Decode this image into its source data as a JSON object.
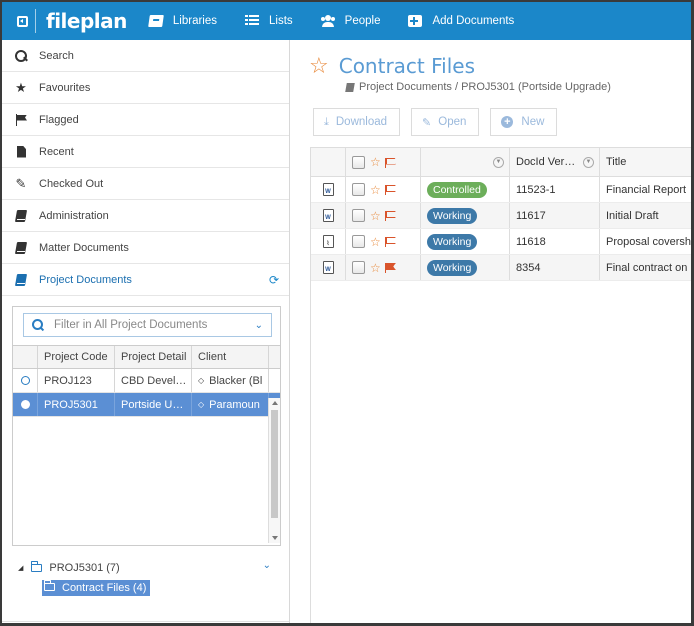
{
  "topbar": {
    "logo": "fileplan",
    "nav": [
      {
        "label": "Libraries",
        "icon": "book-icon"
      },
      {
        "label": "Lists",
        "icon": "list-icon"
      },
      {
        "label": "People",
        "icon": "people-icon"
      },
      {
        "label": "Add Documents",
        "icon": "plus-square-icon"
      }
    ]
  },
  "sidebar": {
    "items": [
      {
        "label": "Search",
        "icon": "search-icon"
      },
      {
        "label": "Favourites",
        "icon": "star-icon"
      },
      {
        "label": "Flagged",
        "icon": "flag-icon"
      },
      {
        "label": "Recent",
        "icon": "document-icon"
      },
      {
        "label": "Checked Out",
        "icon": "edit-icon"
      },
      {
        "label": "Administration",
        "icon": "book-icon"
      },
      {
        "label": "Matter Documents",
        "icon": "book-icon"
      },
      {
        "label": "Project Documents",
        "icon": "book-icon",
        "active": true
      }
    ],
    "filter_placeholder": "Filter in All Project Documents",
    "grid": {
      "columns": [
        "Project Code",
        "Project Detail",
        "Client"
      ],
      "rows": [
        {
          "code": "PROJ123",
          "detail": "CBD Devel…",
          "client": "Blacker (Bl",
          "selected": false
        },
        {
          "code": "PROJ5301",
          "detail": "Portside U…",
          "client": "Paramoun",
          "selected": true
        }
      ]
    },
    "tree": {
      "root": "PROJ5301 (7)",
      "child": "Contract Files (4)"
    }
  },
  "main": {
    "title": "Contract Files",
    "breadcrumb": "Project Documents / PROJ5301 (Portside Upgrade)",
    "toolbar": {
      "download": "Download",
      "open": "Open",
      "new": "New"
    },
    "grid": {
      "columns": [
        "",
        "",
        "",
        "DocId Ver…",
        "Title"
      ],
      "rows": [
        {
          "type": "W",
          "flagged": false,
          "status": "Controlled",
          "status_color": "#6cae5a",
          "docid": "11523-1",
          "title": "Financial Report"
        },
        {
          "type": "W",
          "flagged": false,
          "status": "Working",
          "status_color": "#3d79a8",
          "docid": "11617",
          "title": "Initial Draft"
        },
        {
          "type": "PDF",
          "flagged": false,
          "status": "Working",
          "status_color": "#3d79a8",
          "docid": "11618",
          "title": "Proposal covershe"
        },
        {
          "type": "W",
          "flagged": true,
          "status": "Working",
          "status_color": "#3d79a8",
          "docid": "8354",
          "title": "Final contract on k"
        }
      ]
    }
  },
  "colors": {
    "brand": "#1b87c9",
    "accent_star": "#e8893a",
    "selection": "#5b8fd4"
  }
}
